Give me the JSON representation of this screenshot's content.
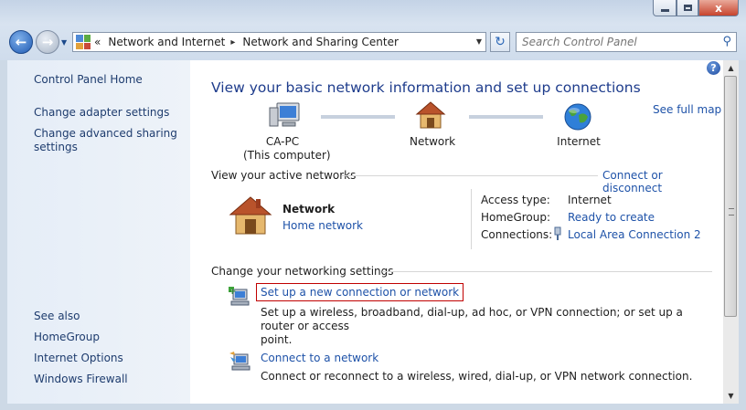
{
  "window": {
    "controls": [
      "minimize",
      "maximize",
      "close"
    ],
    "close_glyph": "x"
  },
  "address": {
    "overflow": "«",
    "crumbs": [
      "Network and Internet",
      "Network and Sharing Center"
    ],
    "separator": "▸"
  },
  "search": {
    "placeholder": "Search Control Panel"
  },
  "leftnav": {
    "home": "Control Panel Home",
    "adapter": "Change adapter settings",
    "advanced_line1": "Change advanced sharing",
    "advanced_line2": "settings",
    "see_also": "See also",
    "homegroup": "HomeGroup",
    "internet_options": "Internet Options",
    "firewall": "Windows Firewall"
  },
  "main": {
    "title": "View your basic network information and set up connections",
    "see_full_map": "See full map",
    "map": {
      "computer_name": "CA-PC",
      "computer_sub": "(This computer)",
      "network": "Network",
      "internet": "Internet"
    },
    "active_networks": {
      "heading": "View your active networks",
      "connect_link": "Connect or disconnect",
      "network_name": "Network",
      "network_type": "Home network",
      "access_label": "Access type:",
      "access_value": "Internet",
      "homegroup_label": "HomeGroup:",
      "homegroup_value": "Ready to create",
      "connections_label": "Connections:",
      "connections_value": "Local Area Connection 2"
    },
    "settings": {
      "heading": "Change your networking settings",
      "setup_link": "Set up a new connection or network",
      "setup_desc_line1": "Set up a wireless, broadband, dial-up, ad hoc, or VPN connection; or set up a router or access",
      "setup_desc_line2": "point.",
      "connect_link": "Connect to a network",
      "connect_desc": "Connect or reconnect to a wireless, wired, dial-up, or VPN network connection."
    }
  },
  "icons": [
    "back-arrow-icon",
    "forward-arrow-icon",
    "control-panel-icon",
    "refresh-icon",
    "search-icon",
    "help-icon",
    "computer-icon",
    "house-icon",
    "globe-icon",
    "ethernet-icon",
    "new-connection-icon",
    "connect-network-icon"
  ],
  "colors": {
    "link": "#1e52a8",
    "title": "#1e3c8c",
    "highlight_box": "#c00000"
  }
}
